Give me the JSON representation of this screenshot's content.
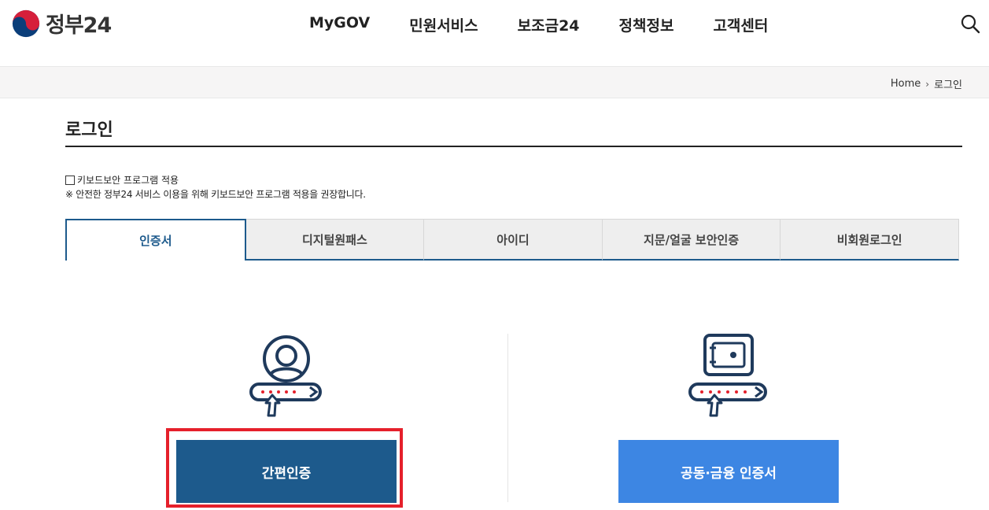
{
  "header": {
    "logo_text": "정부24",
    "nav": [
      "MyGOV",
      "민원서비스",
      "보조금24",
      "정책정보",
      "고객센터"
    ],
    "search_icon": "search-icon"
  },
  "breadcrumb": {
    "home": "Home",
    "current": "로그인"
  },
  "page": {
    "title": "로그인"
  },
  "keyboard_security": {
    "checkbox_label": "키보드보안 프로그램 적용",
    "checked": false,
    "notice": "※ 안전한 정부24 서비스 이용을 위해 키보드보안 프로그램 적용을 권장합니다."
  },
  "tabs": [
    {
      "label": "인증서",
      "active": true
    },
    {
      "label": "디지털원패스",
      "active": false
    },
    {
      "label": "아이디",
      "active": false
    },
    {
      "label": "지문/얼굴 보안인증",
      "active": false
    },
    {
      "label": "비회원로그인",
      "active": false
    }
  ],
  "methods": {
    "simple": {
      "label": "간편인증",
      "icon": "user-password-icon"
    },
    "cert": {
      "label": "공동·금융 인증서",
      "icon": "safe-password-icon"
    }
  },
  "colors": {
    "primary": "#1d5a8c",
    "secondary_button": "#3d86e3",
    "highlight": "#e5202b",
    "icon_dark": "#1f3a5c",
    "icon_red": "#e5202b"
  }
}
